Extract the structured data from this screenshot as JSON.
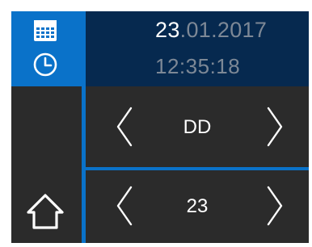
{
  "datetime": {
    "date_day": "23",
    "date_rest": ".01.2017",
    "time": "12:35:18"
  },
  "sidebar": {
    "items": [
      {
        "icon": "calendar-icon",
        "active": true
      },
      {
        "icon": "clock-icon",
        "active": true
      },
      {
        "icon": "home-icon",
        "active": false
      }
    ]
  },
  "field_selector": {
    "value": "DD"
  },
  "value_selector": {
    "value": "23"
  },
  "colors": {
    "accent": "#0a72c9",
    "header_bg": "#06294f",
    "panel_bg": "#2b2b2b",
    "text_primary": "#ffffff",
    "text_muted": "#7d8896"
  }
}
